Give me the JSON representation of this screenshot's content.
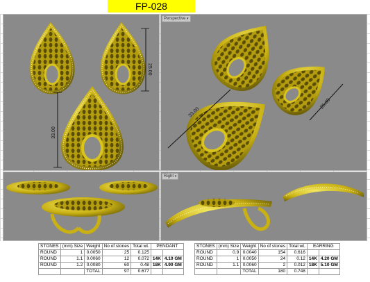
{
  "title": "FP-028",
  "viewports": {
    "top_left": {
      "tab": ""
    },
    "top_right": {
      "tab": "Perspective"
    },
    "bottom_left": {
      "tab": ""
    },
    "bottom_right": {
      "tab": "Right"
    }
  },
  "dimensions": {
    "tl_height_small": "25.00",
    "tl_height_large": "33.00",
    "tr_length": "33.00",
    "tr_length_small": "25.00"
  },
  "colors": {
    "gold": "#d8c41c",
    "gold_dark": "#8a7a10",
    "viewport_bg": "#8a8a8a",
    "title_bg": "#ffff00",
    "karat_text": "#1f2fa0"
  },
  "tables": [
    {
      "label": "PENDANT",
      "headers": [
        "STONES",
        "(mm) Size",
        "Weight",
        "No of stones",
        "Total wt."
      ],
      "rows": [
        [
          "ROUND",
          "1",
          "0.0050",
          "25",
          "0.125"
        ],
        [
          "ROUND",
          "1.1",
          "0.0060",
          "12",
          "0.072"
        ],
        [
          "ROUND",
          "1.2",
          "0.0080",
          "60",
          "0.48"
        ]
      ],
      "total": {
        "label": "TOTAL",
        "stones": "97",
        "weight": "0.677"
      },
      "metals": [
        {
          "karat": "14K",
          "weight": "4.10 GM"
        },
        {
          "karat": "18K",
          "weight": "4.90 GM"
        }
      ]
    },
    {
      "label": "EARRING",
      "headers": [
        "STONES",
        "(mm) Size",
        "Weight",
        "No of stones",
        "Total wt."
      ],
      "rows": [
        [
          "ROUND",
          "0.9",
          "0.0040",
          "154",
          "0.616"
        ],
        [
          "ROUND",
          "1",
          "0.0050",
          "24",
          "0.12"
        ],
        [
          "ROUND",
          "1.1",
          "0.0060",
          "2",
          "0.012"
        ]
      ],
      "total": {
        "label": "TOTAL",
        "stones": "180",
        "weight": "0.748"
      },
      "metals": [
        {
          "karat": "14K",
          "weight": "4.20 GM"
        },
        {
          "karat": "18K",
          "weight": "5.10 GM"
        }
      ]
    }
  ]
}
